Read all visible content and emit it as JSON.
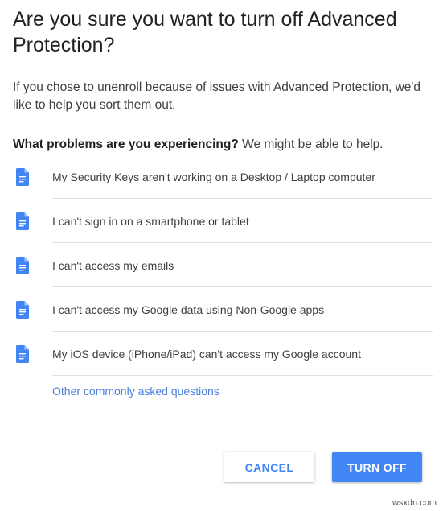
{
  "dialog": {
    "title": "Are you sure you want to turn off Advanced Protection?",
    "intro": "If you chose to unenroll because of issues with Advanced Protection, we'd like to help you sort them out.",
    "question_bold": "What problems are you experiencing?",
    "question_rest": " We might be able to help.",
    "items": [
      {
        "label": "My Security Keys aren't working on a Desktop / Laptop computer",
        "icon": "document-icon"
      },
      {
        "label": "I can't sign in on a smartphone or tablet",
        "icon": "document-icon"
      },
      {
        "label": "I can't access my emails",
        "icon": "document-icon"
      },
      {
        "label": "I can't access my Google data using Non-Google apps",
        "icon": "document-icon"
      },
      {
        "label": "My iOS device (iPhone/iPad) can't access my Google account",
        "icon": "document-icon"
      }
    ],
    "more_link": "Other commonly asked questions",
    "cancel_label": "CANCEL",
    "turn_off_label": "TURN OFF"
  },
  "watermark": "wsxdn.com",
  "colors": {
    "accent": "#4285f4",
    "link": "#4a7fdc",
    "icon": "#4285f4",
    "divider": "#e0e0e0"
  }
}
